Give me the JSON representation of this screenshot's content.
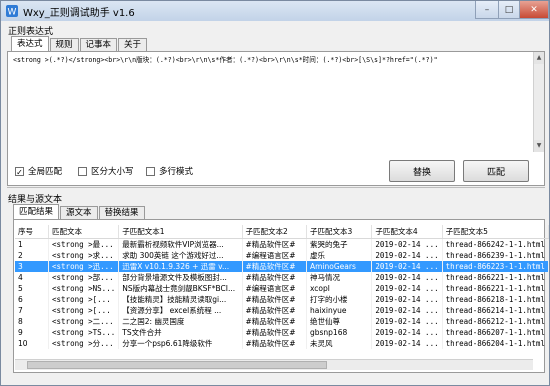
{
  "window": {
    "title": "Wxy_正则调试助手  v1.6",
    "minimize": "–",
    "maximize": "□",
    "close": "✕"
  },
  "section_regex_label": "正则表达式",
  "top_tabs": [
    "表达式",
    "规则",
    "记事本",
    "关于"
  ],
  "regex_value": "<strong >(.*?)</strong><br>\\r\\n版块：(.*?)<br>\\r\\n\\s*作者：(.*?)<br>\\r\\n\\s*时间：(.*?)<br>[\\S\\s]*?href=\"(.*?)\"",
  "options": [
    {
      "label": "全局匹配",
      "checked": true
    },
    {
      "label": "区分大小写",
      "checked": false
    },
    {
      "label": "多行模式",
      "checked": false
    }
  ],
  "buttons": {
    "replace": "替换",
    "match": "匹配"
  },
  "section_results_label": "结果与源文本",
  "result_tabs": [
    "匹配结果",
    "源文本",
    "替换结果"
  ],
  "columns": [
    "序号",
    "匹配文本",
    "子匹配文本1",
    "子匹配文本2",
    "子匹配文本3",
    "子匹配文本4",
    "子匹配文本5"
  ],
  "rows": [
    [
      "1",
      "<strong >最...",
      "最新霸析视频软件VIP浏览器...",
      "#精品软件区#",
      "紫哭的兔子",
      "2019-02-14 ...",
      "thread-866242-1-1.html"
    ],
    [
      "2",
      "<strong >求...",
      "求助 300英链 这个游戏好过...",
      "#编程语言区#",
      "虚乐",
      "2019-02-14 ...",
      "thread-866239-1-1.html"
    ],
    [
      "3",
      "<strong >迅...",
      "迅雷X v10.1.9.326 + 迅雷 v...",
      "#精品软件区#",
      "AminoGears",
      "2019-02-14 ...",
      "thread-866223-1-1.html"
    ],
    [
      "4",
      "<strong >部...",
      "部分背景墙源文件及模板图封...",
      "#精品软件区#",
      "神马情况",
      "2019-02-14 ...",
      "thread-866221-1-1.html"
    ],
    [
      "5",
      "<strong >NS...",
      "NS版内幕战士竟剑靓BKSF*BCI...",
      "#编程语言区#",
      "xcopl",
      "2019-02-14 ...",
      "thread-866221-1-1.html"
    ],
    [
      "6",
      "<strong >[...",
      "【技能精灵】技能精灵读取gi...",
      "#精品软件区#",
      "打字的小楼",
      "2019-02-14 ...",
      "thread-866218-1-1.html"
    ],
    [
      "7",
      "<strong >[...",
      "【资源分享】 excel系统程 ...",
      "#精品软件区#",
      "haixinyue",
      "2019-02-14 ...",
      "thread-866214-1-1.html"
    ],
    [
      "8",
      "<strong >二...",
      "二之国2: 幽灵国度",
      "#精品软件区#",
      "绝世仙尊",
      "2019-02-14 ...",
      "thread-866212-1-1.html"
    ],
    [
      "9",
      "<strong >TS...",
      "TS文件合并",
      "#精品软件区#",
      "gbsnp168",
      "2019-02-14 ...",
      "thread-866207-1-1.html"
    ],
    [
      "10",
      "<strong >分...",
      "分享一个psp6.61降级软件",
      "#精品软件区#",
      "未灵风",
      "2019-02-14 ...",
      "thread-866204-1-1.html"
    ]
  ],
  "selected_row": 3,
  "colors": {
    "selection": "#3399ff",
    "titlebar": "#c2d3e8",
    "close": "#c74a35"
  }
}
